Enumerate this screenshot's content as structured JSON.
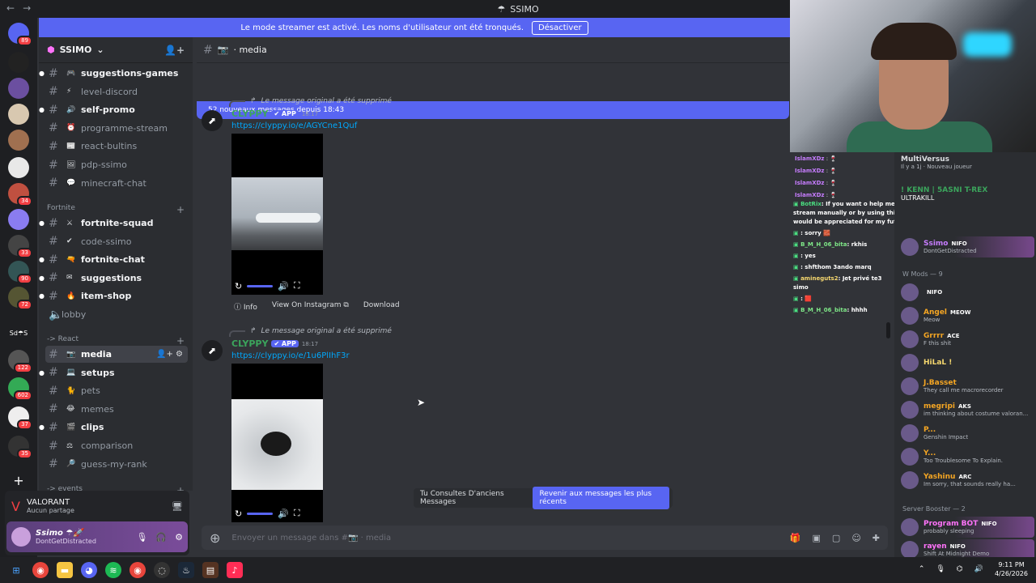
{
  "window": {
    "title": "SSIMO"
  },
  "banner": {
    "text": "Le mode streamer est activé. Les noms d'utilisateur ont été tronqués.",
    "button": "Désactiver"
  },
  "guild_badges": [
    "89",
    "34",
    "33",
    "90",
    "72",
    "122",
    "602",
    "37",
    "35"
  ],
  "server": {
    "name": "SSIMO"
  },
  "channels": [
    {
      "name": "suggestions-games",
      "emoji": "🎮",
      "state": "unread"
    },
    {
      "name": "level-discord",
      "emoji": "⚡",
      "state": "muted"
    },
    {
      "name": "self-promo",
      "emoji": "🔊",
      "state": "unread"
    },
    {
      "name": "programme-stream",
      "emoji": "⏰",
      "state": "muted"
    },
    {
      "name": "react-bultins",
      "emoji": "📰",
      "state": "muted"
    },
    {
      "name": "pdp-ssimo",
      "emoji": "🖼",
      "state": "muted"
    },
    {
      "name": "minecraft-chat",
      "emoji": "💬",
      "state": "muted"
    }
  ],
  "cat_fortnite": "Fortnite",
  "fortnite_channels": [
    {
      "name": "fortnite-squad",
      "emoji": "⚔",
      "state": "unread"
    },
    {
      "name": "code-ssimo",
      "emoji": "✔",
      "state": "muted"
    },
    {
      "name": "fortnite-chat",
      "emoji": "🔫",
      "state": "unread"
    },
    {
      "name": "suggestions",
      "emoji": "✉",
      "state": "unread"
    },
    {
      "name": "item-shop",
      "emoji": "🔥",
      "state": "unread"
    }
  ],
  "lobby": "lobby",
  "cat_react": "-> React",
  "react_channels": [
    {
      "name": "media",
      "emoji": "📷",
      "state": "active"
    },
    {
      "name": "setups",
      "emoji": "💻",
      "state": "unread"
    },
    {
      "name": "pets",
      "emoji": "🐈",
      "state": "muted"
    },
    {
      "name": "memes",
      "emoji": "😂",
      "state": "muted"
    },
    {
      "name": "clips",
      "emoji": "🎬",
      "state": "unread"
    },
    {
      "name": "comparison",
      "emoji": "⚖",
      "state": "muted"
    },
    {
      "name": "guess-my-rank",
      "emoji": "🔎",
      "state": "muted"
    }
  ],
  "cat_events": "-> events",
  "game": {
    "title": "VALORANT",
    "sub": "Aucun partage"
  },
  "user": {
    "name": "Ssimo ☂🚀",
    "status": "DontGetDistracted"
  },
  "chat": {
    "channel": "media",
    "new_bar": "52 nouveaux messages depuis 18:43",
    "messages": [
      {
        "reply": "Le message original a été supprimé",
        "author": "CLYPPY",
        "tag": "✔ APP",
        "time": "18:17",
        "link": "https://clyppy.io/e/AGYCne1Quf"
      },
      {
        "reply": "Le message original a été supprimé",
        "author": "CLYPPY",
        "tag": "✔ APP",
        "time": "18:17",
        "link": "https://clyppy.io/e/1u6PlIhF3r"
      }
    ],
    "buttons": {
      "info": "ⓘ Info",
      "view": "View On Instagram ⧉",
      "download": "Download"
    },
    "old": {
      "text": "Tu Consultes D'anciens Messages",
      "jump": "Revenir aux messages les plus récents"
    },
    "composer_placeholder": "Envoyer un message dans #📷 · media"
  },
  "stream_chat": [
    {
      "nick": "IslamXDz",
      "msg": ": 🍷",
      "color": "#c77dff"
    },
    {
      "nick": "IslamXDz",
      "msg": ": 🍷",
      "color": "#c77dff"
    },
    {
      "nick": "IslamXDz",
      "msg": ": 🍷",
      "color": "#c77dff"
    },
    {
      "nick": "IslamXDz",
      "msg": ": 🍷",
      "color": "#c77dff"
    }
  ],
  "stream_wide": [
    {
      "nick": "BotRix",
      "msg": ": If you want o help me by cliping funny/ good moments from the stream manually or by using this commande !clip (number of sec clipped) would be appreciated for my future reel/ tiktok content 📩 Thank you 💚",
      "color": "#4ade80"
    },
    {
      "nick": "",
      "msg": ": sorry 🧱",
      "color": "#f23f43"
    },
    {
      "nick": "B_M_H_06_bita",
      "msg": ": rkhis",
      "color": "#7ee787"
    },
    {
      "nick": "",
      "msg": ": yes",
      "color": "#f23f43"
    },
    {
      "nick": "",
      "msg": ": shfthom 3ando marq",
      "color": "#f23f43"
    },
    {
      "nick": "amineguts2",
      "msg": ": Jet privé te3 simo",
      "color": "#f5d76e"
    },
    {
      "nick": "",
      "msg": ": 🟥",
      "color": "#f23f43"
    },
    {
      "nick": "B_M_H_06_bita",
      "msg": ": hhhh",
      "color": "#7ee787"
    }
  ],
  "members": {
    "top1": {
      "name": "MultiVersus",
      "sub": "Il y a 1j · Nouveau joueur"
    },
    "top2": {
      "name": "! KENN | 5ASNI T-REX",
      "sub": "ULTRAKILL"
    },
    "ssimo": {
      "name": "Ssimo",
      "tag": "NIFO",
      "sub": "DontGetDistracted"
    },
    "mods_header": "W Mods — 9",
    "mods": [
      {
        "name": "",
        "tag": "NIFO",
        "sub": "",
        "color": "#f23f43"
      },
      {
        "name": "Angel",
        "tag": "MEOW",
        "sub": "Meow",
        "color": "#f5a623"
      },
      {
        "name": "Grrrr",
        "tag": "ACE",
        "sub": "F this shit",
        "color": "#f5a623"
      },
      {
        "name": "HiLaL !",
        "tag": "",
        "sub": "",
        "color": "#f5d76e"
      },
      {
        "name": "J.Basset",
        "tag": "",
        "sub": "They call me macrorecorder",
        "color": "#f5a623"
      },
      {
        "name": "megripi",
        "tag": "AKS",
        "sub": "im thinking about costume valoran...",
        "color": "#f5a623"
      },
      {
        "name": "P...",
        "tag": "",
        "sub": "Genshin Impact",
        "color": "#f5a623"
      },
      {
        "name": "Y...",
        "tag": "",
        "sub": "Too Troublesome To Explain.",
        "color": "#f5a623"
      },
      {
        "name": "Yashinu",
        "tag": "ARC",
        "sub": "Im sorry, that sounds really ha...",
        "color": "#f5a623"
      }
    ],
    "boost_header": "Server Booster — 2",
    "boosters": [
      {
        "name": "Program BOT",
        "tag": "NIFO",
        "sub": "probably sleeping",
        "color": "#ff73fa"
      },
      {
        "name": "rayen",
        "tag": "NIFO",
        "sub": "Shift At Midnight Demo",
        "color": "#ff73fa"
      }
    ]
  },
  "clock": {
    "time": "9:11 PM",
    "date": "4/26/2026"
  }
}
